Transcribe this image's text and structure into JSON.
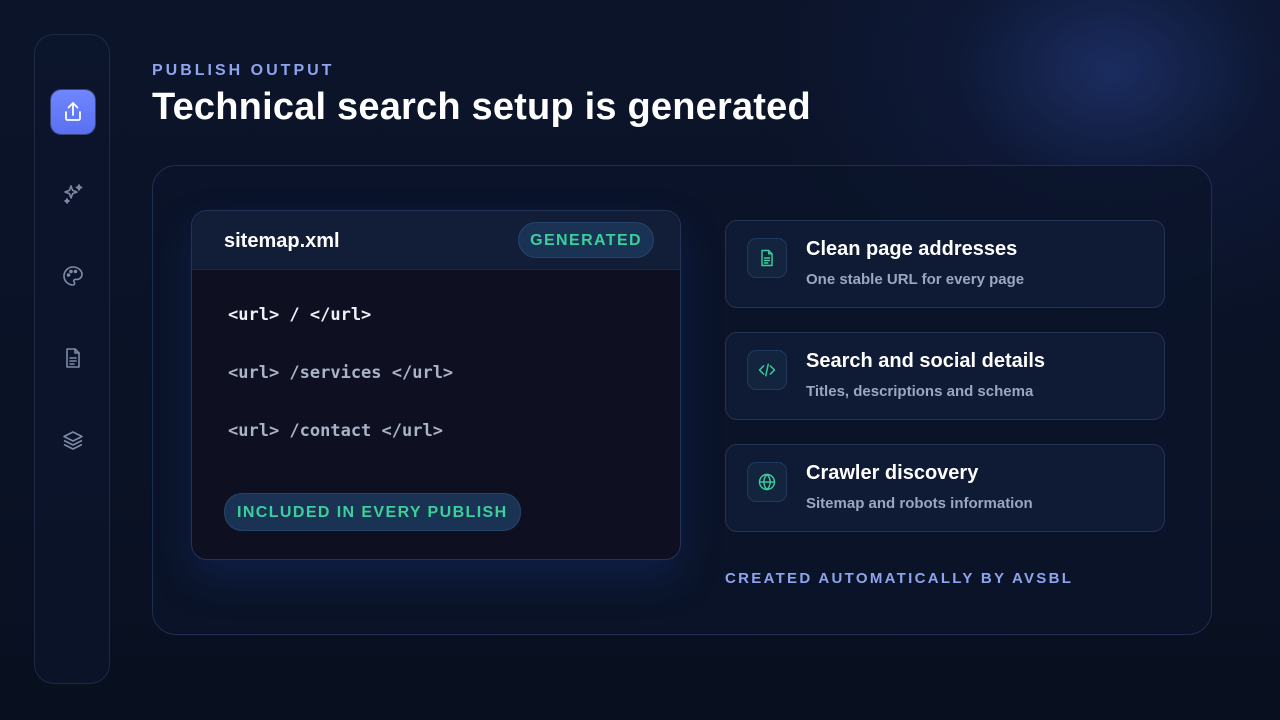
{
  "sidebar": {
    "items": [
      {
        "icon": "share-upload-icon",
        "active": true
      },
      {
        "icon": "sparkles-icon",
        "active": false
      },
      {
        "icon": "palette-icon",
        "active": false
      },
      {
        "icon": "document-icon",
        "active": false
      },
      {
        "icon": "layers-icon",
        "active": false
      }
    ]
  },
  "header": {
    "eyebrow": "PUBLISH OUTPUT",
    "title": "Technical search setup is generated"
  },
  "code_panel": {
    "file_name": "sitemap.xml",
    "status_badge": "GENERATED",
    "lines": [
      "<url> / </url>",
      "<url> /services </url>",
      "<url> /contact </url>"
    ],
    "footer_badge": "INCLUDED IN EVERY PUBLISH"
  },
  "features": [
    {
      "icon": "document-icon",
      "title": "Clean page addresses",
      "description": "One stable URL for every page"
    },
    {
      "icon": "code-icon",
      "title": "Search and social details",
      "description": "Titles, descriptions and schema"
    },
    {
      "icon": "globe-icon",
      "title": "Crawler discovery",
      "description": "Sitemap and robots information"
    }
  ],
  "footer_note": "CREATED AUTOMATICALLY BY AVSBL",
  "colors": {
    "accent": "#6f86ff",
    "success": "#3ccf9b",
    "eyebrow": "#8fa4ee",
    "background": "#0a1226"
  }
}
